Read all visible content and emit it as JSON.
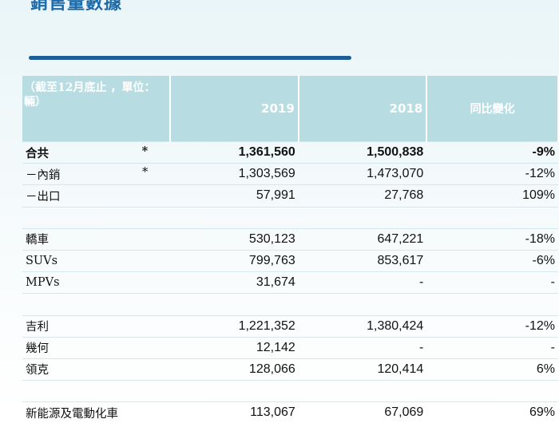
{
  "page": {
    "title": "銷售量數據",
    "accent_color": "#1f5d99",
    "header_bg": "#b7dde3"
  },
  "table": {
    "headers": {
      "label": "（截至12月底止  ，單位：輛）",
      "col_2019": "2019",
      "col_2018": "2018",
      "col_change": "同比變化"
    },
    "rows": [
      {
        "label": "合共",
        "star": "*",
        "v2019": "1,361,560",
        "v2018": "1,500,838",
        "change": "-9%",
        "bold": true
      },
      {
        "label": "－內銷",
        "star": "*",
        "v2019": "1,303,569",
        "v2018": "1,473,070",
        "change": "-12%"
      },
      {
        "label": "－出口",
        "star": "",
        "v2019": "57,991",
        "v2018": "27,768",
        "change": "109%"
      },
      {
        "spacer": true
      },
      {
        "label": "轎車",
        "star": "",
        "v2019": "530,123",
        "v2018": "647,221",
        "change": "-18%"
      },
      {
        "label": "SUVs",
        "star": "",
        "v2019": "799,763",
        "v2018": "853,617",
        "change": "-6%"
      },
      {
        "label": "MPVs",
        "star": "",
        "v2019": "31,674",
        "v2018": "-",
        "change": "-"
      },
      {
        "spacer": true
      },
      {
        "label": "吉利",
        "star": "",
        "v2019": "1,221,352",
        "v2018": "1,380,424",
        "change": "-12%"
      },
      {
        "label": "幾何",
        "star": "",
        "v2019": "12,142",
        "v2018": "-",
        "change": "-"
      },
      {
        "label": "領克",
        "star": "",
        "v2019": "128,066",
        "v2018": "120,414",
        "change": "6%"
      },
      {
        "spacer": true
      },
      {
        "label": "新能源及電動化車",
        "star": "",
        "v2019": "113,067",
        "v2018": "67,069",
        "change": "69%"
      }
    ]
  }
}
